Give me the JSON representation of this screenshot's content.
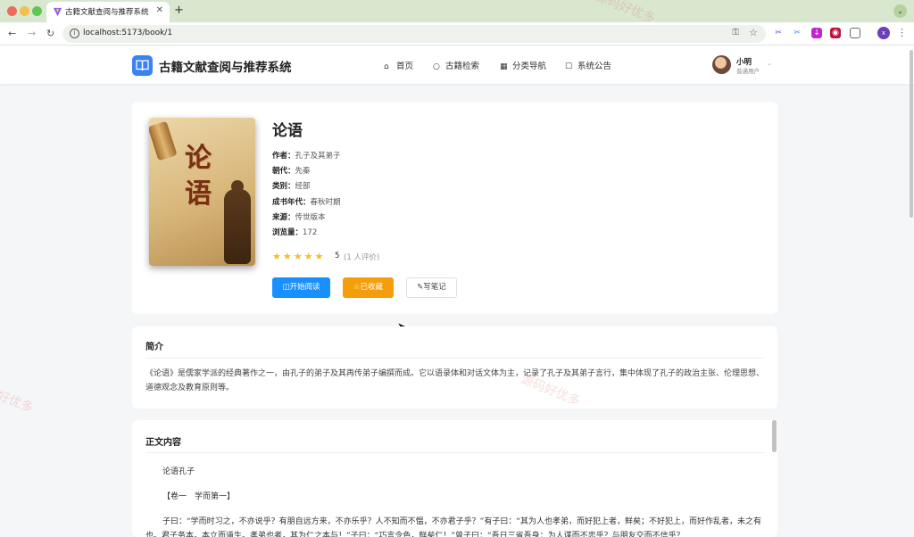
{
  "browser": {
    "tab_title": "古籍文献查阅与推荐系统",
    "new_tab": "+",
    "tab_close": "✕",
    "url": "localhost:5173/book/1",
    "profile_initial": "x"
  },
  "header": {
    "site_title": "古籍文献查阅与推荐系统",
    "nav": [
      {
        "label": "首页",
        "icon": "home-icon"
      },
      {
        "label": "古籍检索",
        "icon": "search-icon"
      },
      {
        "label": "分类导航",
        "icon": "grid-icon"
      },
      {
        "label": "系统公告",
        "icon": "notice-icon"
      }
    ],
    "user": {
      "name": "小明",
      "role": "普通用户"
    }
  },
  "book": {
    "title": "论语",
    "cover_text": [
      "论",
      "语"
    ],
    "meta": [
      {
        "key": "作者：",
        "value": "孔子及其弟子"
      },
      {
        "key": "朝代：",
        "value": "先秦"
      },
      {
        "key": "类别：",
        "value": "经部"
      },
      {
        "key": "成书年代：",
        "value": "春秋时期"
      },
      {
        "key": "来源：",
        "value": "传世版本"
      },
      {
        "key": "浏览量：",
        "value": "172"
      }
    ],
    "stars": "★★★★★",
    "rating": "5",
    "rating_count": "(1 人评价)",
    "buttons": {
      "read": "开始阅读",
      "favorite": "已收藏",
      "note": "写笔记"
    }
  },
  "intro": {
    "title": "简介",
    "text": "《论语》是儒家学派的经典著作之一，由孔子的弟子及其再传弟子编撰而成。它以语录体和对话文体为主，记录了孔子及其弟子言行，集中体现了孔子的政治主张、伦理思想、道德观念及教育原则等。"
  },
  "content": {
    "title": "正文内容",
    "line1": "论语孔子",
    "line2": "【卷一　学而第一】",
    "paragraph": "子曰：“学而时习之，不亦说乎？有朋自远方来，不亦乐乎？人不知而不愠，不亦君子乎？”有子曰：“其为人也孝弟，而好犯上者，鲜矣；不好犯上，而好作乱者，未之有也。君子务本，本立而道生。孝弟也者，其为仁之本与！”子曰：“巧言令色，鲜矣仁！”曾子曰：“吾日三省吾身：为人谋而不忠乎？与朋友交而不信乎？"
  },
  "watermarks": [
    "源码好优多",
    "好优多",
    "源码好优多"
  ]
}
